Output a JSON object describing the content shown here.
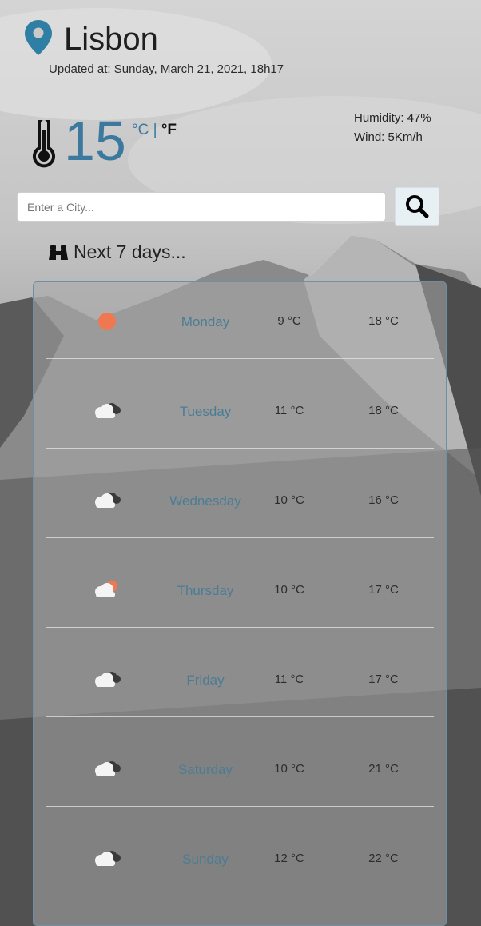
{
  "location": {
    "city": "Lisbon",
    "updated": "Updated at: Sunday, March 21, 2021, 18h17"
  },
  "current": {
    "temperature": "15",
    "unit_c": "°C",
    "unit_separator": "|",
    "unit_f": "°F",
    "humidity_label": "Humidity:",
    "humidity_value": "47%",
    "wind_label": "Wind:",
    "wind_value": "5Km/h"
  },
  "search": {
    "placeholder": "Enter a City..."
  },
  "forecast": {
    "heading": "Next 7 days...",
    "days": [
      {
        "day": "Monday",
        "min": "9 °C",
        "max": "18 °C",
        "icon": "sun-icon"
      },
      {
        "day": "Tuesday",
        "min": "11 °C",
        "max": "18 °C",
        "icon": "clouds-icon"
      },
      {
        "day": "Wednesday",
        "min": "10 °C",
        "max": "16 °C",
        "icon": "clouds-icon"
      },
      {
        "day": "Thursday",
        "min": "10 °C",
        "max": "17 °C",
        "icon": "partly-cloudy-icon"
      },
      {
        "day": "Friday",
        "min": "11 °C",
        "max": "17 °C",
        "icon": "clouds-icon"
      },
      {
        "day": "Saturday",
        "min": "10 °C",
        "max": "21 °C",
        "icon": "clouds-icon"
      },
      {
        "day": "Sunday",
        "min": "12 °C",
        "max": "22 °C",
        "icon": "clouds-icon"
      }
    ]
  },
  "colors": {
    "accent": "#3b7a9e",
    "sun": "#f07850"
  }
}
